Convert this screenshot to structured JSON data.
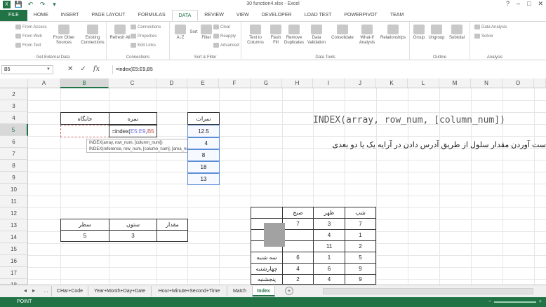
{
  "window": {
    "title": "30 function4.xlsx - Excel",
    "controls": [
      "?",
      "–",
      "□",
      "✕"
    ]
  },
  "quick_access": [
    "💾",
    "↶",
    "↷",
    "▾"
  ],
  "tabs": [
    "FILE",
    "HOME",
    "INSERT",
    "PAGE LAYOUT",
    "FORMULAS",
    "DATA",
    "REVIEW",
    "VIEW",
    "DEVELOPER",
    "LOAD TEST",
    "POWERPIVOT",
    "TEAM"
  ],
  "ribbon": {
    "external_small": [
      "From Access",
      "From Web",
      "From Text"
    ],
    "from_other": "From Other Sources",
    "existing": "Existing Connections",
    "group_external": "Get External Data",
    "refresh": "Refresh All",
    "conn_small": [
      "Connections",
      "Properties",
      "Edit Links"
    ],
    "group_connections": "Connections",
    "sort_az": "A↓Z",
    "sort": "Sort",
    "filter": "Filter",
    "filter_small": [
      "Clear",
      "Reapply",
      "Advanced"
    ],
    "group_sort": "Sort & Filter",
    "tools": [
      "Text to Columns",
      "Flash Fill",
      "Remove Duplicates",
      "Data Validation",
      "Consolidate",
      "What-If Analysis",
      "Relationships"
    ],
    "group_tools": "Data Tools",
    "outline": [
      "Group",
      "Ungroup",
      "Subtotal"
    ],
    "group_outline": "Outline",
    "analysis": [
      "Data Analysis",
      "Solver"
    ],
    "group_analysis": "Analysis"
  },
  "formula_bar": {
    "name_box": "B5",
    "fx": "fx",
    "formula": "=index(E5:E9,B5"
  },
  "columns": [
    "A",
    "B",
    "C",
    "D",
    "E",
    "F",
    "G",
    "H",
    "I",
    "J",
    "K",
    "L",
    "M",
    "N",
    "O"
  ],
  "rows": [
    "2",
    "3",
    "4",
    "5",
    "6",
    "7",
    "8",
    "9",
    "10",
    "11",
    "12",
    "13",
    "14",
    "15",
    "16",
    "17",
    "18"
  ],
  "table1": {
    "b4": "جایگاه",
    "c4": "نمره",
    "c5_prefix": "=index(",
    "c5_ref": "E5:E9",
    "c5_comma": ",",
    "c5_b5": "B5"
  },
  "tooltip": {
    "line1": "INDEX(array, row_num, [column_num])",
    "line2": "INDEX(reference, row_num, [column_num], [area_num])"
  },
  "grades": {
    "header": "نمرات",
    "values": [
      "12.5",
      "4",
      "8",
      "18",
      "13"
    ]
  },
  "syntax_text": "INDEX(array, row_num, [column_num])",
  "description": "ست آوردن مقدار سلول از طریق آدرس دادن در آرایه یک یا دو بعدی",
  "table2": {
    "headers": [
      "سطر",
      "ستون",
      "مقدار"
    ],
    "values": [
      "5",
      "3",
      ""
    ]
  },
  "table3": {
    "headers": [
      "",
      "صبح",
      "ظهر",
      "شب"
    ],
    "rows": [
      [
        "",
        "7",
        "3",
        "7"
      ],
      [
        "",
        "",
        "4",
        "1"
      ],
      [
        "",
        "",
        "11",
        "2"
      ],
      [
        "سه شنبه",
        "6",
        "1",
        "5"
      ],
      [
        "چهارشنبه",
        "4",
        "6",
        "9"
      ],
      [
        "پنجشنبه",
        "2",
        "4",
        "9"
      ]
    ]
  },
  "sheet_tabs": [
    "...",
    "CHar+Code",
    "Year+Month+Day+Date",
    "Hour+Minute+Second+Time",
    "Match",
    "Index"
  ],
  "status": {
    "mode": "POINT"
  }
}
